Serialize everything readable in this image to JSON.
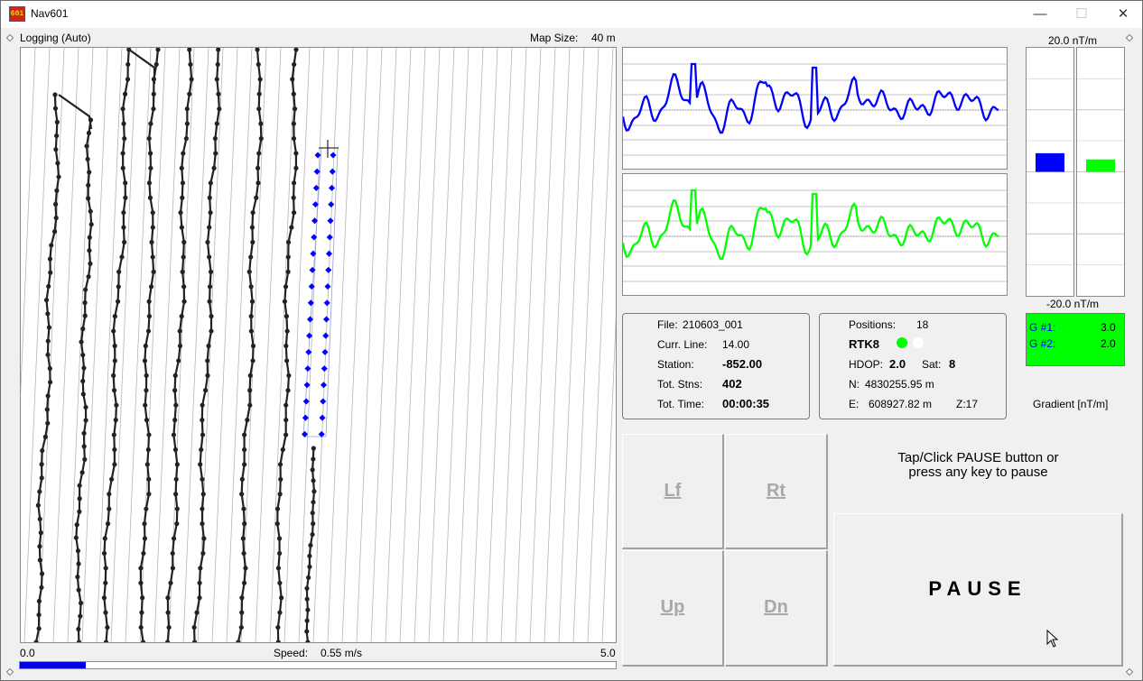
{
  "window": {
    "title": "Nav601",
    "icon_text": "601",
    "icon": "nav601-app-icon"
  },
  "titlebar_buttons": {
    "minimize": "—",
    "maximize": "☐",
    "close": "✕"
  },
  "map": {
    "mode_label": "Logging (Auto)",
    "map_size_label": "Map Size:",
    "map_size_value": "40 m"
  },
  "speed": {
    "min": "0.0",
    "label": "Speed:",
    "value": "0.55 m/s",
    "max": "5.0",
    "fraction": 0.11
  },
  "gradient_scale": {
    "top": "20.0 nT/m",
    "bottom": "-20.0 nT/m",
    "caption": "Gradient [nT/m]"
  },
  "gradient_bars": {
    "g1_value": 3.0,
    "g2_value": 2.0,
    "g1_color": "#0000ff",
    "g2_color": "#00ff00"
  },
  "g_box": {
    "g1_label": "G #1:",
    "g1_value": "3.0",
    "g2_label": "G #2:",
    "g2_value": "2.0",
    "bg_color": "#00ff00"
  },
  "file_info": {
    "file_label": "File:",
    "file_value": "210603_001",
    "curr_line_label": "Curr. Line:",
    "curr_line_value": "14.00",
    "station_label": "Station:",
    "station_value": "-852.00",
    "tot_stns_label": "Tot. Stns:",
    "tot_stns_value": "402",
    "tot_time_label": "Tot. Time:",
    "tot_time_value": "00:00:35"
  },
  "gps_info": {
    "positions_label": "Positions:",
    "positions_value": "18",
    "rtk_label": "RTK8",
    "hdop_label": "HDOP:",
    "hdop_value": "2.0",
    "sat_label": "Sat:",
    "sat_value": "8",
    "n_label": "N:",
    "n_value": "4830255.95 m",
    "e_label": "E:",
    "e_value": "608927.82 m",
    "z_label": "Z:17"
  },
  "nav_buttons": {
    "left": "Lf",
    "right": "Rt",
    "up": "Up",
    "down": "Dn"
  },
  "pause": {
    "hint_line1": "Tap/Click PAUSE button or",
    "hint_line2": "press any key to pause",
    "button_label": "PAUSE"
  },
  "colors": {
    "series1": "#0000ff",
    "series2": "#00ff00",
    "track": "#222222",
    "speed_bar": "#0000e0"
  }
}
